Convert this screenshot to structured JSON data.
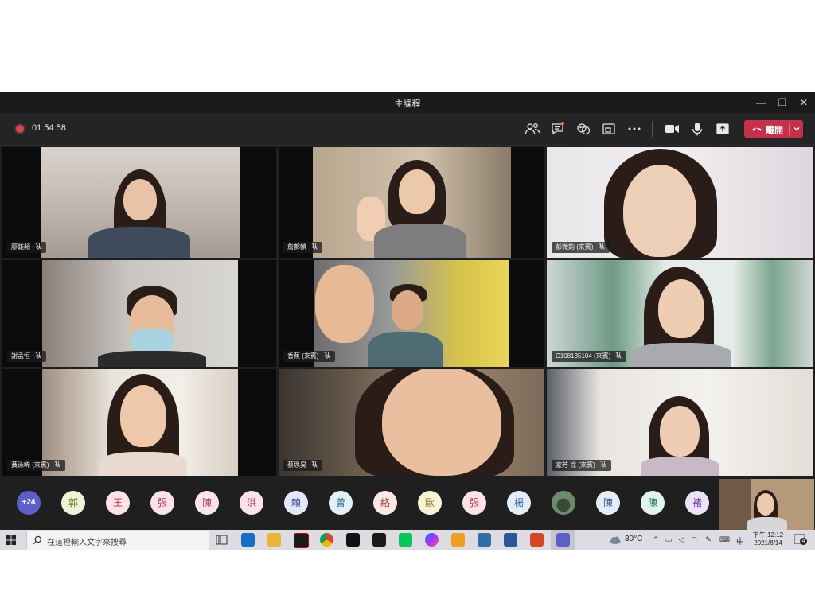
{
  "window": {
    "title": "主課程",
    "min": "—",
    "max": "❐",
    "close": "✕"
  },
  "toolbar": {
    "timer": "01:54:58",
    "leave_label": "離開",
    "icons": [
      "participants-icon",
      "chat-icon",
      "reactions-icon",
      "share-tray-icon",
      "more-icon",
      "camera-icon",
      "mic-icon",
      "share-icon"
    ]
  },
  "participants": [
    {
      "name": "廖鈺頻"
    },
    {
      "name": "詹鄜鎖"
    },
    {
      "name": "彭微鈞 (來賓)"
    },
    {
      "name": "謝孟恒"
    },
    {
      "name": "香蕉 (來賓)"
    },
    {
      "name": "C108135104 (來賓)"
    },
    {
      "name": "黃泳晞 (來賓)"
    },
    {
      "name": "蔡思昊"
    },
    {
      "name": "家芳 涂 (來賓)"
    }
  ],
  "roster": {
    "more_count": "+24",
    "avatars": [
      {
        "initial": "郭",
        "bg": "#eef3d8",
        "fg": "#6a7a2a"
      },
      {
        "initial": "王",
        "bg": "#fbe3e6",
        "fg": "#b03a4b"
      },
      {
        "initial": "張",
        "bg": "#fbe3ea",
        "fg": "#a8345a"
      },
      {
        "initial": "陳",
        "bg": "#fce4ec",
        "fg": "#b03a6a"
      },
      {
        "initial": "洪",
        "bg": "#fbe3ea",
        "fg": "#a8345a"
      },
      {
        "initial": "賴",
        "bg": "#e3e7f7",
        "fg": "#3b4ba0"
      },
      {
        "initial": "曾",
        "bg": "#e2f0f7",
        "fg": "#2f6f90"
      },
      {
        "initial": "絡",
        "bg": "#fbe7e3",
        "fg": "#a8483a"
      },
      {
        "initial": "歐",
        "bg": "#f9f3d6",
        "fg": "#8a7420"
      },
      {
        "initial": "張",
        "bg": "#fbe3e6",
        "fg": "#b03a4b"
      },
      {
        "initial": "楊",
        "bg": "#e3ecf9",
        "fg": "#2f5aa0"
      },
      {
        "initial": "",
        "bg": "#6d8a6a",
        "fg": "#ffffff"
      },
      {
        "initial": "陳",
        "bg": "#e3eef9",
        "fg": "#2f5a90"
      },
      {
        "initial": "陳",
        "bg": "#e0f3ee",
        "fg": "#2a7a64"
      },
      {
        "initial": "褚",
        "bg": "#ece3f7",
        "fg": "#6a3ba0"
      }
    ]
  },
  "taskbar": {
    "search_placeholder": "在這裡輸入文字來搜尋",
    "weather": "30°C",
    "ime": "中",
    "time": "下午 12:12",
    "date": "2021/8/14",
    "notifications": "4"
  },
  "colors": {
    "accent": "#5b5fc7",
    "leave": "#c4314b",
    "record": "#e0424f"
  }
}
